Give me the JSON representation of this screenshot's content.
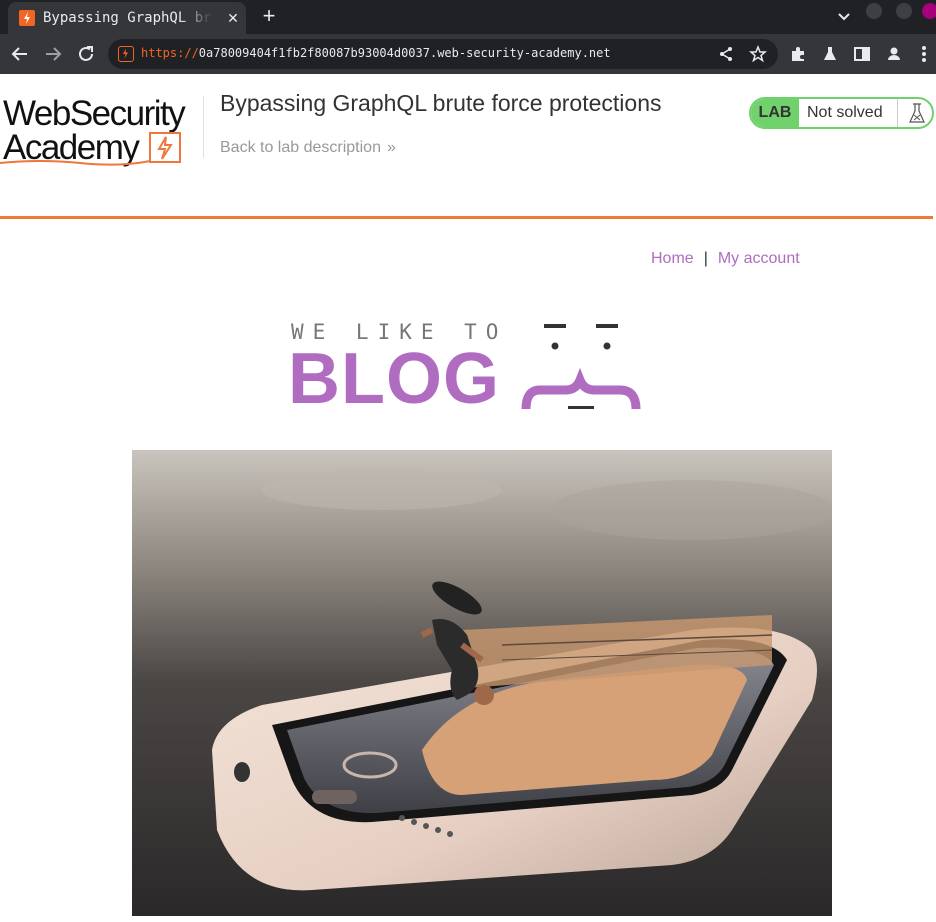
{
  "browser": {
    "tab_title": "Bypassing GraphQL brute force protections",
    "new_tab_symbol": "+",
    "tab_close_symbol": "✕",
    "url_scheme": "https://",
    "url_host": "0a78009404f1fb2f80087b93004d0037.web-security-academy.net",
    "icons": [
      "back-arrow-icon",
      "forward-arrow-icon",
      "reload-icon",
      "share-icon",
      "star-icon",
      "extensions-icon",
      "labs-flask-icon",
      "side-panel-icon",
      "profile-icon",
      "menu-icon"
    ]
  },
  "lab_header": {
    "logo_line1": "WebSecurity",
    "logo_line2": "Academy",
    "title": "Bypassing GraphQL brute force protections",
    "back_link": "Back to lab description",
    "back_chevron": "»",
    "status_badge": "LAB",
    "status_text": "Not solved",
    "accent_color": "#f0773b",
    "status_color": "#70d16d"
  },
  "nav": {
    "home": "Home",
    "separator": "|",
    "my_account": "My account",
    "link_color": "#b06cc0"
  },
  "banner": {
    "small_text": "WE LIKE TO",
    "big_text": "BLOG",
    "color": "#b06cc0"
  },
  "hero_image": {
    "description_icon": "skateboarder-on-phone-image"
  }
}
